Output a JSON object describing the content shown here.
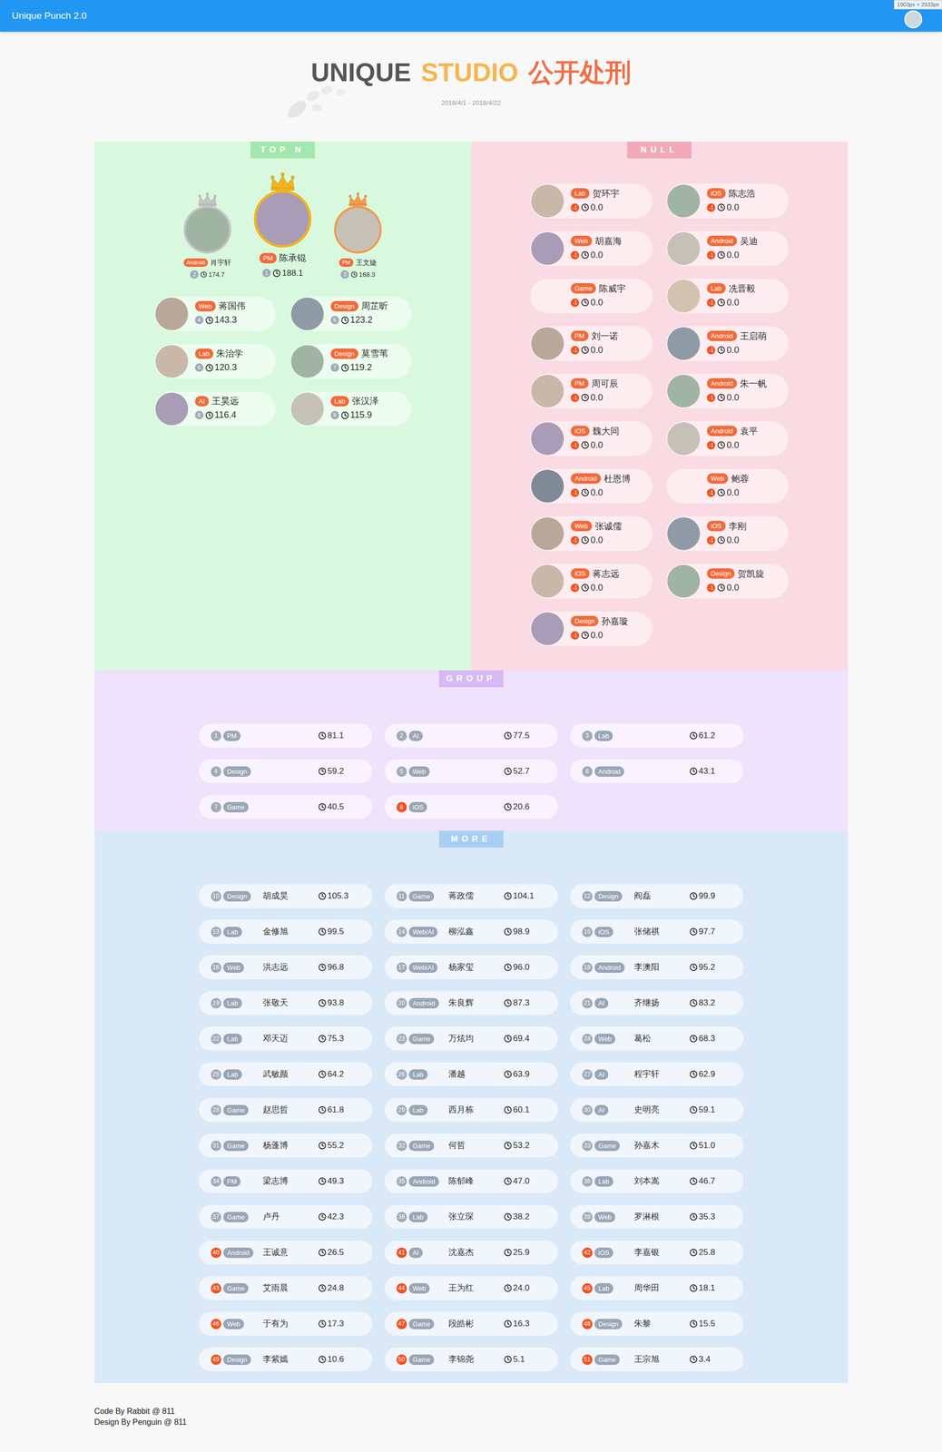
{
  "top_bar": {
    "title": "Unique Punch 2.0",
    "size_badge": "1903px × 2933px"
  },
  "header": {
    "title_parts": [
      {
        "text": "UNIQUE",
        "color": "#555555"
      },
      {
        "text": "STUDIO",
        "color": "#f8b44c"
      },
      {
        "text": "公开处刑",
        "color": "#f26e45"
      }
    ],
    "date_range": "2018/4/1 - 2018/4/22"
  },
  "top_n": {
    "label": "TOP N",
    "podium": [
      {
        "rank": "2",
        "tag": "Android",
        "name": "肖宇轩",
        "hours": "174.7",
        "color": "#c4c4c4",
        "kind": "side"
      },
      {
        "rank": "1",
        "tag": "PM",
        "name": "陈承锟",
        "hours": "188.1",
        "color": "#f5b31a",
        "kind": "champion"
      },
      {
        "rank": "3",
        "tag": "PM",
        "name": "王文婕",
        "hours": "168.3",
        "color": "#f29a4a",
        "kind": "side"
      }
    ],
    "list": [
      {
        "rank": "4",
        "tag": "Web",
        "name": "蒋国伟",
        "hours": "143.3",
        "color": "#a0aab8",
        "has_avatar": true
      },
      {
        "rank": "5",
        "tag": "Design",
        "name": "周芷昕",
        "hours": "123.2",
        "color": "#a0aab8",
        "has_avatar": true
      },
      {
        "rank": "6",
        "tag": "Lab",
        "name": "朱治学",
        "hours": "120.3",
        "color": "#a0aab8",
        "has_avatar": true
      },
      {
        "rank": "7",
        "tag": "Design",
        "name": "莫雪苇",
        "hours": "119.2",
        "color": "#a0aab8",
        "has_avatar": true
      },
      {
        "rank": "8",
        "tag": "AI",
        "name": "王昊远",
        "hours": "116.4",
        "color": "#a0aab8",
        "has_avatar": true
      },
      {
        "rank": "9",
        "tag": "Lab",
        "name": "张汉泽",
        "hours": "115.9",
        "color": "#a0aab8",
        "has_avatar": true
      }
    ]
  },
  "null": {
    "label": "NULL",
    "members": [
      {
        "rank": "-1",
        "tag": "Lab",
        "name": "贺环宇",
        "hours": "0.0",
        "color": "#f4511e",
        "has_avatar": true
      },
      {
        "rank": "-1",
        "tag": "iOS",
        "name": "陈志浩",
        "hours": "0.0",
        "color": "#f4511e",
        "has_avatar": true
      },
      {
        "rank": "-1",
        "tag": "Web",
        "name": "胡嘉海",
        "hours": "0.0",
        "color": "#f4511e",
        "has_avatar": true
      },
      {
        "rank": "-1",
        "tag": "Android",
        "name": "吴迪",
        "hours": "0.0",
        "color": "#f4511e",
        "has_avatar": true
      },
      {
        "rank": "-1",
        "tag": "Game",
        "name": "陈威宇",
        "hours": "0.0",
        "color": "#f4511e",
        "has_avatar": false
      },
      {
        "rank": "-1",
        "tag": "Lab",
        "name": "冼晋毅",
        "hours": "0.0",
        "color": "#f4511e",
        "has_avatar": true
      },
      {
        "rank": "-1",
        "tag": "PM",
        "name": "刘一诺",
        "hours": "0.0",
        "color": "#f4511e",
        "has_avatar": true
      },
      {
        "rank": "-1",
        "tag": "Android",
        "name": "王启萌",
        "hours": "0.0",
        "color": "#f4511e",
        "has_avatar": true
      },
      {
        "rank": "-1",
        "tag": "PM",
        "name": "周可辰",
        "hours": "0.0",
        "color": "#f4511e",
        "has_avatar": true
      },
      {
        "rank": "-1",
        "tag": "Android",
        "name": "朱一帆",
        "hours": "0.0",
        "color": "#f4511e",
        "has_avatar": true
      },
      {
        "rank": "-1",
        "tag": "iOS",
        "name": "魏大同",
        "hours": "0.0",
        "color": "#f4511e",
        "has_avatar": true
      },
      {
        "rank": "-1",
        "tag": "Android",
        "name": "袁平",
        "hours": "0.0",
        "color": "#f4511e",
        "has_avatar": true
      },
      {
        "rank": "-1",
        "tag": "Android",
        "name": "杜恩博",
        "hours": "0.0",
        "color": "#f4511e",
        "has_avatar": true
      },
      {
        "rank": "-1",
        "tag": "Web",
        "name": "鲍蓉",
        "hours": "0.0",
        "color": "#f4511e",
        "has_avatar": false
      },
      {
        "rank": "-1",
        "tag": "Web",
        "name": "张诚儒",
        "hours": "0.0",
        "color": "#f4511e",
        "has_avatar": true
      },
      {
        "rank": "-1",
        "tag": "iOS",
        "name": "李刚",
        "hours": "0.0",
        "color": "#f4511e",
        "has_avatar": true
      },
      {
        "rank": "-1",
        "tag": "iOS",
        "name": "蒋志远",
        "hours": "0.0",
        "color": "#f4511e",
        "has_avatar": true
      },
      {
        "rank": "-1",
        "tag": "Design",
        "name": "贺凯旋",
        "hours": "0.0",
        "color": "#f4511e",
        "has_avatar": true
      },
      {
        "rank": "-1",
        "tag": "Design",
        "name": "孙嘉璇",
        "hours": "0.0",
        "color": "#f4511e",
        "has_avatar": true
      }
    ]
  },
  "group": {
    "label": "GROUP",
    "groups": [
      {
        "rank": "1",
        "tag": "PM",
        "hours": "81.1",
        "color": "#a0aab8"
      },
      {
        "rank": "2",
        "tag": "AI",
        "hours": "77.5",
        "color": "#a0aab8"
      },
      {
        "rank": "3",
        "tag": "Lab",
        "hours": "61.2",
        "color": "#a0aab8"
      },
      {
        "rank": "4",
        "tag": "Design",
        "hours": "59.2",
        "color": "#a0aab8"
      },
      {
        "rank": "5",
        "tag": "Web",
        "hours": "52.7",
        "color": "#a0aab8"
      },
      {
        "rank": "6",
        "tag": "Android",
        "hours": "43.1",
        "color": "#a0aab8"
      },
      {
        "rank": "7",
        "tag": "Game",
        "hours": "40.5",
        "color": "#a0aab8"
      },
      {
        "rank": "8",
        "tag": "iOS",
        "hours": "20.6",
        "color": "#f4511e"
      }
    ]
  },
  "more": {
    "label": "MORE",
    "members": [
      {
        "rank": "10",
        "tag": "Design",
        "name": "胡成昊",
        "hours": "105.3",
        "color": "#a0aab8"
      },
      {
        "rank": "11",
        "tag": "Game",
        "name": "蒋政儒",
        "hours": "104.1",
        "color": "#a0aab8"
      },
      {
        "rank": "12",
        "tag": "Design",
        "name": "阎磊",
        "hours": "99.9",
        "color": "#a0aab8"
      },
      {
        "rank": "13",
        "tag": "Lab",
        "name": "金修旭",
        "hours": "99.5",
        "color": "#a0aab8"
      },
      {
        "rank": "14",
        "tag": "Web/AI",
        "name": "柳泓鑫",
        "hours": "98.9",
        "color": "#a0aab8"
      },
      {
        "rank": "15",
        "tag": "iOS",
        "name": "张储祺",
        "hours": "97.7",
        "color": "#a0aab8"
      },
      {
        "rank": "16",
        "tag": "Web",
        "name": "洪志远",
        "hours": "96.8",
        "color": "#a0aab8"
      },
      {
        "rank": "17",
        "tag": "Web/AI",
        "name": "杨家玺",
        "hours": "96.0",
        "color": "#a0aab8"
      },
      {
        "rank": "18",
        "tag": "Android",
        "name": "李澳阳",
        "hours": "95.2",
        "color": "#a0aab8"
      },
      {
        "rank": "19",
        "tag": "Lab",
        "name": "张敬天",
        "hours": "93.8",
        "color": "#a0aab8"
      },
      {
        "rank": "20",
        "tag": "Android",
        "name": "朱良辉",
        "hours": "87.3",
        "color": "#a0aab8"
      },
      {
        "rank": "21",
        "tag": "AI",
        "name": "齐继扬",
        "hours": "83.2",
        "color": "#a0aab8"
      },
      {
        "rank": "22",
        "tag": "Lab",
        "name": "邓天迈",
        "hours": "75.3",
        "color": "#a0aab8"
      },
      {
        "rank": "23",
        "tag": "Game",
        "name": "万炫均",
        "hours": "69.4",
        "color": "#a0aab8"
      },
      {
        "rank": "24",
        "tag": "Web",
        "name": "葛松",
        "hours": "68.3",
        "color": "#a0aab8"
      },
      {
        "rank": "25",
        "tag": "Lab",
        "name": "武敏颜",
        "hours": "64.2",
        "color": "#a0aab8"
      },
      {
        "rank": "26",
        "tag": "Lab",
        "name": "潘越",
        "hours": "63.9",
        "color": "#a0aab8"
      },
      {
        "rank": "27",
        "tag": "AI",
        "name": "程宇轩",
        "hours": "62.9",
        "color": "#a0aab8"
      },
      {
        "rank": "28",
        "tag": "Game",
        "name": "赵思哲",
        "hours": "61.8",
        "color": "#a0aab8"
      },
      {
        "rank": "29",
        "tag": "Lab",
        "name": "西月栋",
        "hours": "60.1",
        "color": "#a0aab8"
      },
      {
        "rank": "30",
        "tag": "AI",
        "name": "史明亮",
        "hours": "59.1",
        "color": "#a0aab8"
      },
      {
        "rank": "31",
        "tag": "Game",
        "name": "杨蓬博",
        "hours": "55.2",
        "color": "#a0aab8"
      },
      {
        "rank": "32",
        "tag": "Game",
        "name": "何哲",
        "hours": "53.2",
        "color": "#a0aab8"
      },
      {
        "rank": "33",
        "tag": "Game",
        "name": "孙嘉木",
        "hours": "51.0",
        "color": "#a0aab8"
      },
      {
        "rank": "34",
        "tag": "PM",
        "name": "梁志博",
        "hours": "49.3",
        "color": "#a0aab8"
      },
      {
        "rank": "35",
        "tag": "Android",
        "name": "陈郁峰",
        "hours": "47.0",
        "color": "#a0aab8"
      },
      {
        "rank": "36",
        "tag": "Lab",
        "name": "刘本嵩",
        "hours": "46.7",
        "color": "#a0aab8"
      },
      {
        "rank": "37",
        "tag": "Game",
        "name": "卢丹",
        "hours": "42.3",
        "color": "#a0aab8"
      },
      {
        "rank": "38",
        "tag": "Lab",
        "name": "张立琛",
        "hours": "38.2",
        "color": "#a0aab8"
      },
      {
        "rank": "39",
        "tag": "Web",
        "name": "罗淋根",
        "hours": "35.3",
        "color": "#a0aab8"
      },
      {
        "rank": "40",
        "tag": "Android",
        "name": "王诚意",
        "hours": "26.5",
        "color": "#f4511e"
      },
      {
        "rank": "41",
        "tag": "AI",
        "name": "沈嘉杰",
        "hours": "25.9",
        "color": "#f4511e"
      },
      {
        "rank": "42",
        "tag": "iOS",
        "name": "李嘉银",
        "hours": "25.8",
        "color": "#f4511e"
      },
      {
        "rank": "43",
        "tag": "Game",
        "name": "艾雨晨",
        "hours": "24.8",
        "color": "#f4511e"
      },
      {
        "rank": "44",
        "tag": "Web",
        "name": "王为红",
        "hours": "24.0",
        "color": "#f4511e"
      },
      {
        "rank": "45",
        "tag": "Lab",
        "name": "周华田",
        "hours": "18.1",
        "color": "#f4511e"
      },
      {
        "rank": "46",
        "tag": "Web",
        "name": "于有为",
        "hours": "17.3",
        "color": "#f4511e"
      },
      {
        "rank": "47",
        "tag": "Game",
        "name": "段皓彬",
        "hours": "16.3",
        "color": "#f4511e"
      },
      {
        "rank": "48",
        "tag": "Design",
        "name": "朱黎",
        "hours": "15.5",
        "color": "#f4511e"
      },
      {
        "rank": "49",
        "tag": "Design",
        "name": "李紫嫣",
        "hours": "10.6",
        "color": "#f4511e"
      },
      {
        "rank": "50",
        "tag": "Game",
        "name": "李锦尧",
        "hours": "5.1",
        "color": "#f4511e"
      },
      {
        "rank": "51",
        "tag": "Game",
        "name": "王宗旭",
        "hours": "3.4",
        "color": "#f4511e"
      }
    ]
  },
  "footer": [
    "Code By Rabbit @ 811",
    "Design By Penguin @ 811"
  ]
}
